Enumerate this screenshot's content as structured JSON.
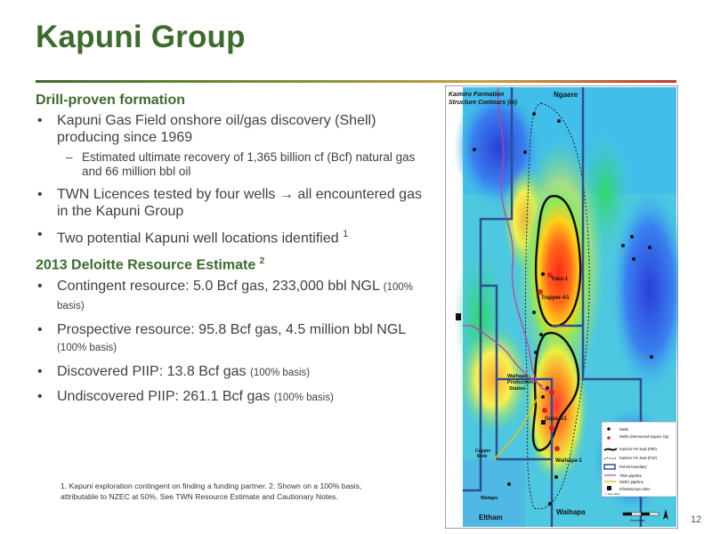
{
  "title": "Kapuni Group",
  "section1": {
    "heading": "Drill-proven formation",
    "b1": "Kapuni Gas Field onshore oil/gas discovery (Shell) producing since 1969",
    "b1_sub": "Estimated ultimate recovery of 1,365 billion cf (Bcf) natural gas and 66 million bbl oil",
    "b2": "TWN Licences tested by four wells → all encountered gas in the Kapuni Group",
    "b3": "Two potential Kapuni well locations identified",
    "b3_sup": "1"
  },
  "section2": {
    "heading": "2013 Deloitte Resource Estimate",
    "heading_sup": "2",
    "items": [
      {
        "text": "Contingent resource: 5.0 Bcf gas, 233,000 bbl NGL",
        "note": "(100% basis)"
      },
      {
        "text": "Prospective resource: 95.8 Bcf gas, 4.5 million bbl NGL",
        "note": "(100% basis)"
      },
      {
        "text": "Discovered PIIP: 13.8 Bcf gas",
        "note": "(100% basis)"
      },
      {
        "text": "Undiscovered PIIP: 261.1 Bcf gas",
        "note": "(100% basis)"
      }
    ]
  },
  "footnote": "1. Kapuni exploration contingent on finding a funding partner. 2. Shown on a 100% basis, attributable to NZEC at 50%. See TWN Resource Estimate and Cautionary Notes.",
  "page_number": "12",
  "map": {
    "title_line1": "Kaimiro  Formation",
    "title_line2": "Structure Contours (m)",
    "place_top": "Ngaere",
    "place_bottom_left": "Eltham",
    "place_bottom_right": "Waihapa",
    "labels": {
      "toko": "Toko-1",
      "trapper": "Trapper-A1",
      "station1": "Waihapa",
      "station2": "Production",
      "station3": "Station",
      "goss": "Goss-A1",
      "waihapa1": "Waihapa-1",
      "copper1": "Copper",
      "copper2": "Moki",
      "waitapu": "Waitapu"
    },
    "legend": [
      {
        "label": "Wells"
      },
      {
        "label": "Wells (intersected Kapuni Gp)"
      },
      {
        "label": "Kaimiro Fm lead (P50)"
      },
      {
        "label": "Kaimiro Fm lead (P10)"
      },
      {
        "label": "Permit boundary"
      },
      {
        "label": "TWN pipeline"
      },
      {
        "label": "NZEC pipeline"
      },
      {
        "label": "Infrastructure sites"
      }
    ],
    "scale_label": "Kilometres",
    "date_label": "7 June 2013",
    "colors": {
      "permit": "#2f4f8f",
      "twn_pipeline": "#c2409a",
      "nzec_pipeline": "#e0c020",
      "well_red": "#e02020"
    }
  }
}
